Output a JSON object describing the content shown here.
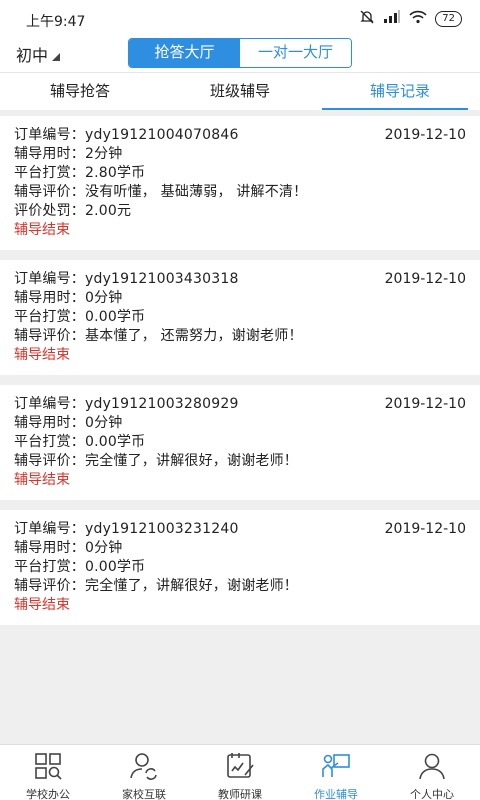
{
  "status_bar": {
    "time": "上午9:47",
    "battery": "72"
  },
  "top_bar": {
    "grade": "初中",
    "segments": [
      "抢答大厅",
      "一对一大厅"
    ]
  },
  "tabs": [
    "辅导抢答",
    "班级辅导",
    "辅导记录"
  ],
  "records": [
    {
      "order_label": "订单编号：",
      "order_no": "ydy19121004070846",
      "date": "2019-12-10",
      "duration_label": "辅导用时：",
      "duration": "2分钟",
      "reward_label": "平台打赏：",
      "reward": "2.80学币",
      "review_label": "辅导评价：",
      "review": "没有听懂， 基础薄弱， 讲解不清！",
      "penalty_label": "评价处罚：",
      "penalty": "2.00元",
      "status": "辅导结束"
    },
    {
      "order_label": "订单编号：",
      "order_no": "ydy19121003430318",
      "date": "2019-12-10",
      "duration_label": "辅导用时：",
      "duration": "0分钟",
      "reward_label": "平台打赏：",
      "reward": "0.00学币",
      "review_label": "辅导评价：",
      "review": "基本懂了， 还需努力，谢谢老师！",
      "status": "辅导结束"
    },
    {
      "order_label": "订单编号：",
      "order_no": "ydy19121003280929",
      "date": "2019-12-10",
      "duration_label": "辅导用时：",
      "duration": "0分钟",
      "reward_label": "平台打赏：",
      "reward": "0.00学币",
      "review_label": "辅导评价：",
      "review": "完全懂了，讲解很好，谢谢老师！",
      "status": "辅导结束"
    },
    {
      "order_label": "订单编号：",
      "order_no": "ydy19121003231240",
      "date": "2019-12-10",
      "duration_label": "辅导用时：",
      "duration": "0分钟",
      "reward_label": "平台打赏：",
      "reward": "0.00学币",
      "review_label": "辅导评价：",
      "review": "完全懂了，讲解很好，谢谢老师！",
      "status": "辅导结束"
    }
  ],
  "bottom_nav": [
    {
      "label": "学校办公",
      "icon": "grid-search-icon"
    },
    {
      "label": "家校互联",
      "icon": "user-sync-icon"
    },
    {
      "label": "教师研课",
      "icon": "notebook-pen-icon"
    },
    {
      "label": "作业辅导",
      "icon": "teacher-board-icon"
    },
    {
      "label": "个人中心",
      "icon": "person-icon"
    }
  ],
  "colors": {
    "accent": "#2e8ee0",
    "status_end": "#d9342b"
  }
}
